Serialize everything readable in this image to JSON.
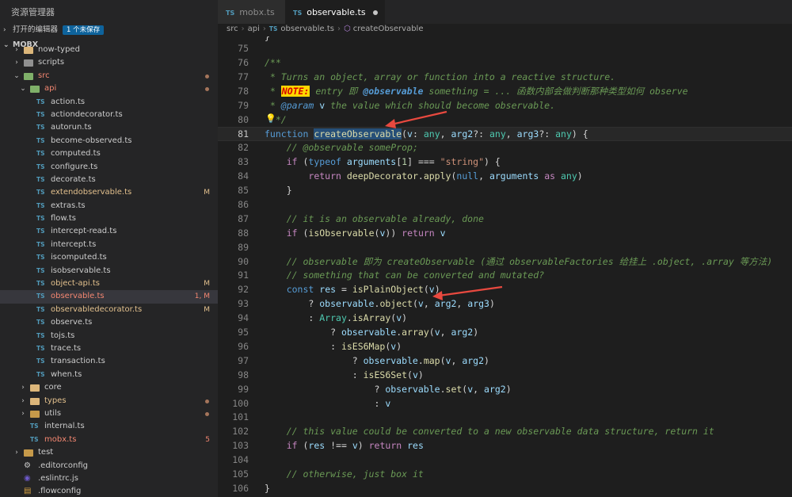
{
  "sidebar": {
    "title": "资源管理器",
    "open_editors": {
      "label": "打开的编辑器",
      "badge": "1 个未保存"
    },
    "root": "MOBX",
    "items": [
      {
        "label": "now-typed",
        "indent": 1,
        "kind": "folder",
        "color": "yellow",
        "status": "",
        "dot": false
      },
      {
        "label": "scripts",
        "indent": 1,
        "kind": "folder",
        "color": "gray",
        "status": "",
        "dot": false
      },
      {
        "label": "src",
        "indent": 1,
        "kind": "folder-open",
        "color": "green",
        "status": "",
        "dot": true,
        "cls": "err"
      },
      {
        "label": "api",
        "indent": 2,
        "kind": "folder-open",
        "color": "green",
        "status": "",
        "dot": true,
        "cls": "err"
      },
      {
        "label": "action.ts",
        "indent": 3,
        "kind": "ts",
        "status": "",
        "dot": false
      },
      {
        "label": "actiondecorator.ts",
        "indent": 3,
        "kind": "ts",
        "status": "",
        "dot": false
      },
      {
        "label": "autorun.ts",
        "indent": 3,
        "kind": "ts",
        "status": "",
        "dot": false
      },
      {
        "label": "become-observed.ts",
        "indent": 3,
        "kind": "ts",
        "status": "",
        "dot": false
      },
      {
        "label": "computed.ts",
        "indent": 3,
        "kind": "ts",
        "status": "",
        "dot": false
      },
      {
        "label": "configure.ts",
        "indent": 3,
        "kind": "ts",
        "status": "",
        "dot": false
      },
      {
        "label": "decorate.ts",
        "indent": 3,
        "kind": "ts",
        "status": "",
        "dot": false
      },
      {
        "label": "extendobservable.ts",
        "indent": 3,
        "kind": "ts",
        "status": "M",
        "dot": false,
        "cls": "mod"
      },
      {
        "label": "extras.ts",
        "indent": 3,
        "kind": "ts",
        "status": "",
        "dot": false
      },
      {
        "label": "flow.ts",
        "indent": 3,
        "kind": "ts",
        "status": "",
        "dot": false
      },
      {
        "label": "intercept-read.ts",
        "indent": 3,
        "kind": "ts",
        "status": "",
        "dot": false
      },
      {
        "label": "intercept.ts",
        "indent": 3,
        "kind": "ts",
        "status": "",
        "dot": false
      },
      {
        "label": "iscomputed.ts",
        "indent": 3,
        "kind": "ts",
        "status": "",
        "dot": false
      },
      {
        "label": "isobservable.ts",
        "indent": 3,
        "kind": "ts",
        "status": "",
        "dot": false
      },
      {
        "label": "object-api.ts",
        "indent": 3,
        "kind": "ts",
        "status": "M",
        "dot": false,
        "cls": "mod"
      },
      {
        "label": "observable.ts",
        "indent": 3,
        "kind": "ts",
        "status": "1, M",
        "dot": false,
        "cls": "err",
        "selected": true
      },
      {
        "label": "observabledecorator.ts",
        "indent": 3,
        "kind": "ts",
        "status": "M",
        "dot": false,
        "cls": "mod"
      },
      {
        "label": "observe.ts",
        "indent": 3,
        "kind": "ts",
        "status": "",
        "dot": false
      },
      {
        "label": "tojs.ts",
        "indent": 3,
        "kind": "ts",
        "status": "",
        "dot": false
      },
      {
        "label": "trace.ts",
        "indent": 3,
        "kind": "ts",
        "status": "",
        "dot": false
      },
      {
        "label": "transaction.ts",
        "indent": 3,
        "kind": "ts",
        "status": "",
        "dot": false
      },
      {
        "label": "when.ts",
        "indent": 3,
        "kind": "ts",
        "status": "",
        "dot": false
      },
      {
        "label": "core",
        "indent": 2,
        "kind": "folder",
        "color": "yellow",
        "status": "",
        "dot": false
      },
      {
        "label": "types",
        "indent": 2,
        "kind": "folder",
        "color": "yellow",
        "status": "",
        "dot": true,
        "cls": "mod"
      },
      {
        "label": "utils",
        "indent": 2,
        "kind": "folder",
        "color": "brown",
        "status": "",
        "dot": true
      },
      {
        "label": "internal.ts",
        "indent": 2,
        "kind": "ts",
        "status": "",
        "dot": false
      },
      {
        "label": "mobx.ts",
        "indent": 2,
        "kind": "ts",
        "status": "5",
        "dot": false,
        "cls": "err"
      },
      {
        "label": "test",
        "indent": 1,
        "kind": "folder",
        "color": "brown",
        "status": "",
        "dot": false
      },
      {
        "label": ".editorconfig",
        "indent": 1,
        "kind": "cfg",
        "status": "",
        "dot": false
      },
      {
        "label": ".eslintrc.js",
        "indent": 1,
        "kind": "eslint",
        "status": "",
        "dot": false
      },
      {
        "label": ".flowconfig",
        "indent": 1,
        "kind": "cfg2",
        "status": "",
        "dot": false
      }
    ]
  },
  "tabs": [
    {
      "label": "mobx.ts",
      "type": "TS"
    },
    {
      "label": "observable.ts",
      "type": "TS"
    }
  ],
  "breadcrumb": [
    "src",
    "api",
    "observable.ts",
    "createObservable"
  ],
  "colors": {
    "accent": "#0e639c",
    "modified": "#e2c08d",
    "error": "#f48771",
    "annotation_arrow": "#e8493f"
  },
  "editor": {
    "current_line": 81,
    "lines": [
      {
        "n": 75,
        "tokens": []
      },
      {
        "n": 76,
        "tokens": [
          [
            "doc",
            "/**"
          ]
        ]
      },
      {
        "n": 77,
        "tokens": [
          [
            "doc",
            " * Turns an object, array or function into a reactive structure."
          ]
        ]
      },
      {
        "n": 78,
        "tokens": [
          [
            "doc",
            " * "
          ],
          [
            "note",
            "NOTE:"
          ],
          [
            "doc",
            " entry 即 "
          ],
          [
            "tagb",
            "@observable"
          ],
          [
            "doc",
            " something = ... 函数内部会做判断那种类型如何 observe"
          ]
        ]
      },
      {
        "n": 79,
        "tokens": [
          [
            "doc",
            " * "
          ],
          [
            "tag",
            "@param"
          ],
          [
            "doc",
            " "
          ],
          [
            "var",
            "v"
          ],
          [
            "doc",
            " the value which should become observable."
          ]
        ]
      },
      {
        "n": 80,
        "tokens": [
          [
            "doc",
            "  */"
          ]
        ]
      },
      {
        "n": 81,
        "tokens": [
          [
            "kw",
            "function"
          ],
          [
            "plain",
            " "
          ],
          [
            "fnhl",
            "createObservable"
          ],
          [
            "plain",
            "("
          ],
          [
            "var",
            "v"
          ],
          [
            "plain",
            ": "
          ],
          [
            "type",
            "any"
          ],
          [
            "plain",
            ", "
          ],
          [
            "var",
            "arg2"
          ],
          [
            "plain",
            "?: "
          ],
          [
            "type",
            "any"
          ],
          [
            "plain",
            ", "
          ],
          [
            "var",
            "arg3"
          ],
          [
            "plain",
            "?: "
          ],
          [
            "type",
            "any"
          ],
          [
            "plain",
            ") {"
          ]
        ]
      },
      {
        "n": 82,
        "tokens": [
          [
            "plain",
            "    "
          ],
          [
            "cmt",
            "// @observable someProp;"
          ]
        ]
      },
      {
        "n": 83,
        "tokens": [
          [
            "plain",
            "    "
          ],
          [
            "ctl",
            "if"
          ],
          [
            "plain",
            " ("
          ],
          [
            "kw",
            "typeof"
          ],
          [
            "plain",
            " "
          ],
          [
            "var",
            "arguments"
          ],
          [
            "plain",
            "["
          ],
          [
            "num",
            "1"
          ],
          [
            "plain",
            "] === "
          ],
          [
            "str",
            "\"string\""
          ],
          [
            "plain",
            ") {"
          ]
        ]
      },
      {
        "n": 84,
        "tokens": [
          [
            "plain",
            "        "
          ],
          [
            "ctl",
            "return"
          ],
          [
            "plain",
            " "
          ],
          [
            "fn",
            "deepDecorator"
          ],
          [
            "plain",
            "."
          ],
          [
            "fn",
            "apply"
          ],
          [
            "plain",
            "("
          ],
          [
            "kw",
            "null"
          ],
          [
            "plain",
            ", "
          ],
          [
            "var",
            "arguments"
          ],
          [
            "plain",
            " "
          ],
          [
            "ctl",
            "as"
          ],
          [
            "plain",
            " "
          ],
          [
            "type",
            "any"
          ],
          [
            "plain",
            ")"
          ]
        ]
      },
      {
        "n": 85,
        "tokens": [
          [
            "plain",
            "    }"
          ]
        ]
      },
      {
        "n": 86,
        "tokens": []
      },
      {
        "n": 87,
        "tokens": [
          [
            "plain",
            "    "
          ],
          [
            "cmt",
            "// it is an observable already, done"
          ]
        ]
      },
      {
        "n": 88,
        "tokens": [
          [
            "plain",
            "    "
          ],
          [
            "ctl",
            "if"
          ],
          [
            "plain",
            " ("
          ],
          [
            "fn",
            "isObservable"
          ],
          [
            "plain",
            "("
          ],
          [
            "var",
            "v"
          ],
          [
            "plain",
            ")) "
          ],
          [
            "ctl",
            "return"
          ],
          [
            "plain",
            " "
          ],
          [
            "var",
            "v"
          ]
        ]
      },
      {
        "n": 89,
        "tokens": []
      },
      {
        "n": 90,
        "tokens": [
          [
            "plain",
            "    "
          ],
          [
            "cmt",
            "// observable 即为 createObservable (通过 observableFactories 给挂上 .object, .array 等方法)"
          ]
        ]
      },
      {
        "n": 91,
        "tokens": [
          [
            "plain",
            "    "
          ],
          [
            "cmt",
            "// something that can be converted and mutated?"
          ]
        ]
      },
      {
        "n": 92,
        "tokens": [
          [
            "plain",
            "    "
          ],
          [
            "kw",
            "const"
          ],
          [
            "plain",
            " "
          ],
          [
            "var",
            "res"
          ],
          [
            "plain",
            " = "
          ],
          [
            "fn",
            "isPlainObject"
          ],
          [
            "plain",
            "("
          ],
          [
            "var",
            "v"
          ],
          [
            "plain",
            ")"
          ]
        ]
      },
      {
        "n": 93,
        "tokens": [
          [
            "plain",
            "        ? "
          ],
          [
            "var",
            "observable"
          ],
          [
            "plain",
            "."
          ],
          [
            "fn",
            "object"
          ],
          [
            "plain",
            "("
          ],
          [
            "var",
            "v"
          ],
          [
            "plain",
            ", "
          ],
          [
            "var",
            "arg2"
          ],
          [
            "plain",
            ", "
          ],
          [
            "var",
            "arg3"
          ],
          [
            "plain",
            ")"
          ]
        ]
      },
      {
        "n": 94,
        "tokens": [
          [
            "plain",
            "        : "
          ],
          [
            "type",
            "Array"
          ],
          [
            "plain",
            "."
          ],
          [
            "fn",
            "isArray"
          ],
          [
            "plain",
            "("
          ],
          [
            "var",
            "v"
          ],
          [
            "plain",
            ")"
          ]
        ]
      },
      {
        "n": 95,
        "tokens": [
          [
            "plain",
            "            ? "
          ],
          [
            "var",
            "observable"
          ],
          [
            "plain",
            "."
          ],
          [
            "fn",
            "array"
          ],
          [
            "plain",
            "("
          ],
          [
            "var",
            "v"
          ],
          [
            "plain",
            ", "
          ],
          [
            "var",
            "arg2"
          ],
          [
            "plain",
            ")"
          ]
        ]
      },
      {
        "n": 96,
        "tokens": [
          [
            "plain",
            "            : "
          ],
          [
            "fn",
            "isES6Map"
          ],
          [
            "plain",
            "("
          ],
          [
            "var",
            "v"
          ],
          [
            "plain",
            ")"
          ]
        ]
      },
      {
        "n": 97,
        "tokens": [
          [
            "plain",
            "                ? "
          ],
          [
            "var",
            "observable"
          ],
          [
            "plain",
            "."
          ],
          [
            "fn",
            "map"
          ],
          [
            "plain",
            "("
          ],
          [
            "var",
            "v"
          ],
          [
            "plain",
            ", "
          ],
          [
            "var",
            "arg2"
          ],
          [
            "plain",
            ")"
          ]
        ]
      },
      {
        "n": 98,
        "tokens": [
          [
            "plain",
            "                : "
          ],
          [
            "fn",
            "isES6Set"
          ],
          [
            "plain",
            "("
          ],
          [
            "var",
            "v"
          ],
          [
            "plain",
            ")"
          ]
        ]
      },
      {
        "n": 99,
        "tokens": [
          [
            "plain",
            "                    ? "
          ],
          [
            "var",
            "observable"
          ],
          [
            "plain",
            "."
          ],
          [
            "fn",
            "set"
          ],
          [
            "plain",
            "("
          ],
          [
            "var",
            "v"
          ],
          [
            "plain",
            ", "
          ],
          [
            "var",
            "arg2"
          ],
          [
            "plain",
            ")"
          ]
        ]
      },
      {
        "n": 100,
        "tokens": [
          [
            "plain",
            "                    : "
          ],
          [
            "var",
            "v"
          ]
        ]
      },
      {
        "n": 101,
        "tokens": []
      },
      {
        "n": 102,
        "tokens": [
          [
            "plain",
            "    "
          ],
          [
            "cmt",
            "// this value could be converted to a new observable data structure, return it"
          ]
        ]
      },
      {
        "n": 103,
        "tokens": [
          [
            "plain",
            "    "
          ],
          [
            "ctl",
            "if"
          ],
          [
            "plain",
            " ("
          ],
          [
            "var",
            "res"
          ],
          [
            "plain",
            " !== "
          ],
          [
            "var",
            "v"
          ],
          [
            "plain",
            ") "
          ],
          [
            "ctl",
            "return"
          ],
          [
            "plain",
            " "
          ],
          [
            "var",
            "res"
          ]
        ]
      },
      {
        "n": 104,
        "tokens": []
      },
      {
        "n": 105,
        "tokens": [
          [
            "plain",
            "    "
          ],
          [
            "cmt",
            "// otherwise, just box it"
          ]
        ]
      },
      {
        "n": 106,
        "tokens": [
          [
            "plain",
            "}"
          ]
        ]
      }
    ]
  }
}
